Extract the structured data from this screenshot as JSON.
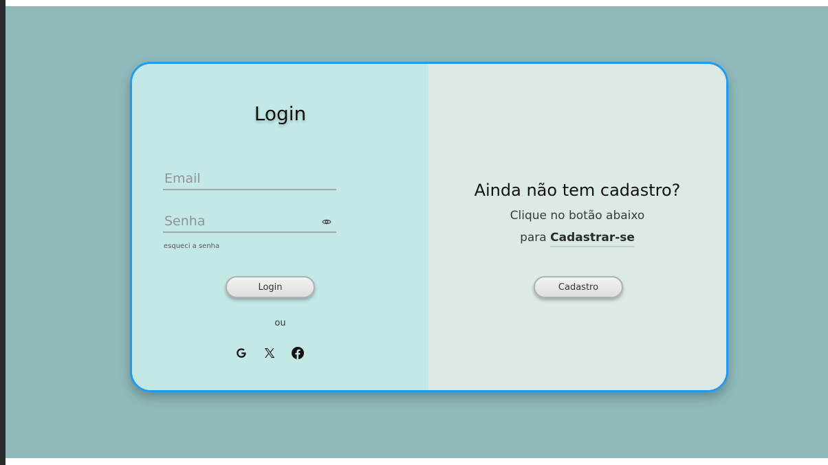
{
  "login_panel": {
    "title": "Login",
    "email_placeholder": "Email",
    "senha_placeholder": "Senha",
    "forgot_label": "esqueci a senha",
    "login_button": "Login",
    "separator": "ou",
    "social_icons": [
      "google-icon",
      "x-icon",
      "facebook-icon"
    ]
  },
  "register_panel": {
    "heading": "Ainda não tem cadastro?",
    "line1": "Clique no botão abaixo",
    "line2_prefix": "para ",
    "line2_emphasis": "Cadastrar-se",
    "cadastro_button": "Cadastro"
  },
  "colors": {
    "background": "#8fb9ba",
    "card_border": "#1f9cf0",
    "left_panel": "#c3e8e6",
    "right_panel": "#dde9e7"
  }
}
